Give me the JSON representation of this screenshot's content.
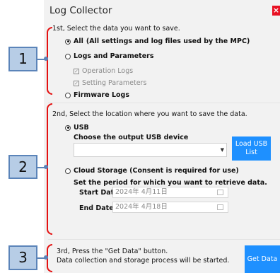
{
  "window": {
    "title": "Log Collector",
    "close_label": "×"
  },
  "step1": {
    "heading": "1st, Select the data you want to save.",
    "options": [
      {
        "label": "All",
        "note": "(All settings and log files used by the MPC)",
        "selected": true
      },
      {
        "label": "Logs and Parameters",
        "selected": false
      },
      {
        "label": "Firmware Logs",
        "selected": false
      }
    ],
    "sub_options": [
      {
        "label": "Operation Logs",
        "checked": true
      },
      {
        "label": "Setting Parameters",
        "checked": true
      }
    ]
  },
  "step2": {
    "heading": "2nd, Select the location where you want to save the data.",
    "usb": {
      "label": "USB",
      "selected": true,
      "device_prompt": "Choose the output USB device",
      "load_button": {
        "line1": "Load USB",
        "line2": "List"
      }
    },
    "cloud": {
      "label": "Cloud Storage (Consent is required for use)",
      "selected": false,
      "period_prompt": "Set the period for which you want to retrieve data.",
      "start_label": "Start Date",
      "start_value": "2024年 4月11日",
      "end_label": "End Date",
      "end_value": "2024年 4月18日"
    }
  },
  "step3": {
    "line1": "3rd, Press the \"Get Data\" button.",
    "line2": "Data collection and storage process will be started.",
    "button": "Get Data"
  },
  "callouts": [
    "1",
    "2",
    "3"
  ],
  "colors": {
    "accent": "#1e90ff",
    "bracket": "#e41111",
    "callout_fill": "#b7cde6",
    "callout_border": "#5b84b9",
    "close": "#e81123"
  }
}
